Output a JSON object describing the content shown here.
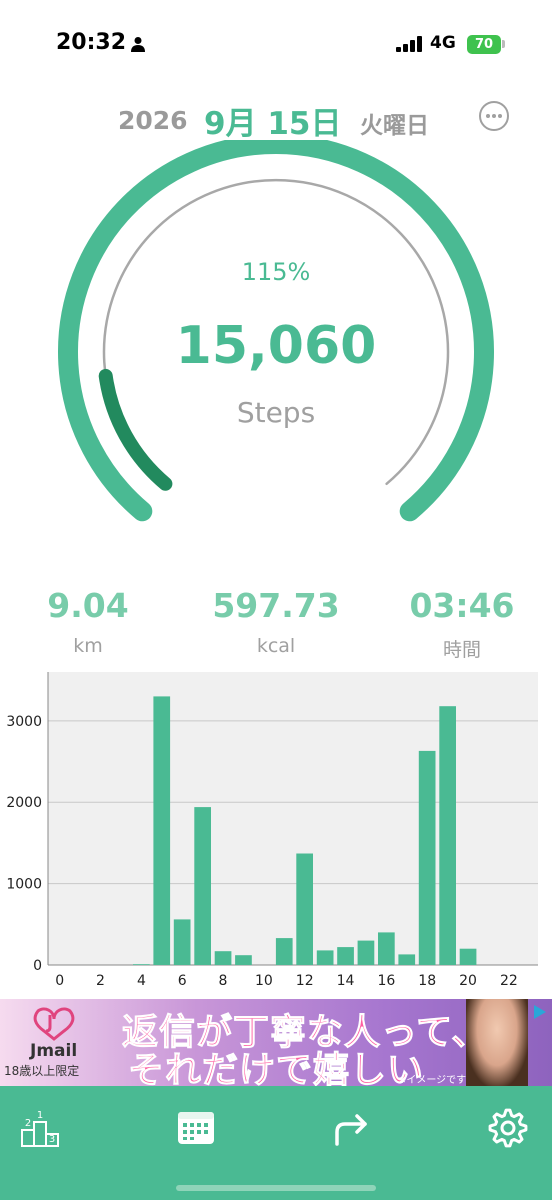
{
  "status_bar": {
    "time": "20:32",
    "network": "4G",
    "battery": "70"
  },
  "header": {
    "year": "2026",
    "month_day": "9月 15日",
    "weekday": "火曜日"
  },
  "gauge": {
    "percent_label": "115%",
    "steps": "15,060",
    "steps_label": "Steps",
    "progress": 1.15
  },
  "stats": [
    {
      "value": "9.04",
      "unit": "km"
    },
    {
      "value": "597.73",
      "unit": "kcal"
    },
    {
      "value": "03:46",
      "unit": "時間"
    }
  ],
  "chart_data": {
    "type": "bar",
    "x": [
      0,
      1,
      2,
      3,
      4,
      5,
      6,
      7,
      8,
      9,
      10,
      11,
      12,
      13,
      14,
      15,
      16,
      17,
      18,
      19,
      20,
      21,
      22,
      23
    ],
    "values": [
      0,
      0,
      0,
      0,
      10,
      3300,
      560,
      1940,
      170,
      120,
      0,
      330,
      1370,
      180,
      220,
      300,
      400,
      130,
      2630,
      3180,
      200,
      0,
      0,
      0
    ],
    "x_ticks": [
      "0",
      "2",
      "4",
      "6",
      "8",
      "10",
      "12",
      "14",
      "16",
      "18",
      "20",
      "22"
    ],
    "y_ticks": [
      "0",
      "1000",
      "2000",
      "3000"
    ],
    "ylim": [
      0,
      3600
    ],
    "grid": true,
    "bar_color": "#4aba93"
  },
  "ad": {
    "brand": "Jmail",
    "age_notice": "18歳以上限定",
    "line1": "返信が丁寧な人って、",
    "line2": "それだけで嬉しい",
    "image_note": "※イメージです"
  },
  "tabs": [
    {
      "icon": "ranking-podium-icon"
    },
    {
      "icon": "calendar-icon"
    },
    {
      "icon": "share-arrow-icon"
    },
    {
      "icon": "gear-icon"
    }
  ],
  "colors": {
    "accent": "#4aba93",
    "accent_dark": "#228a5e",
    "muted": "#a0a0a0"
  }
}
